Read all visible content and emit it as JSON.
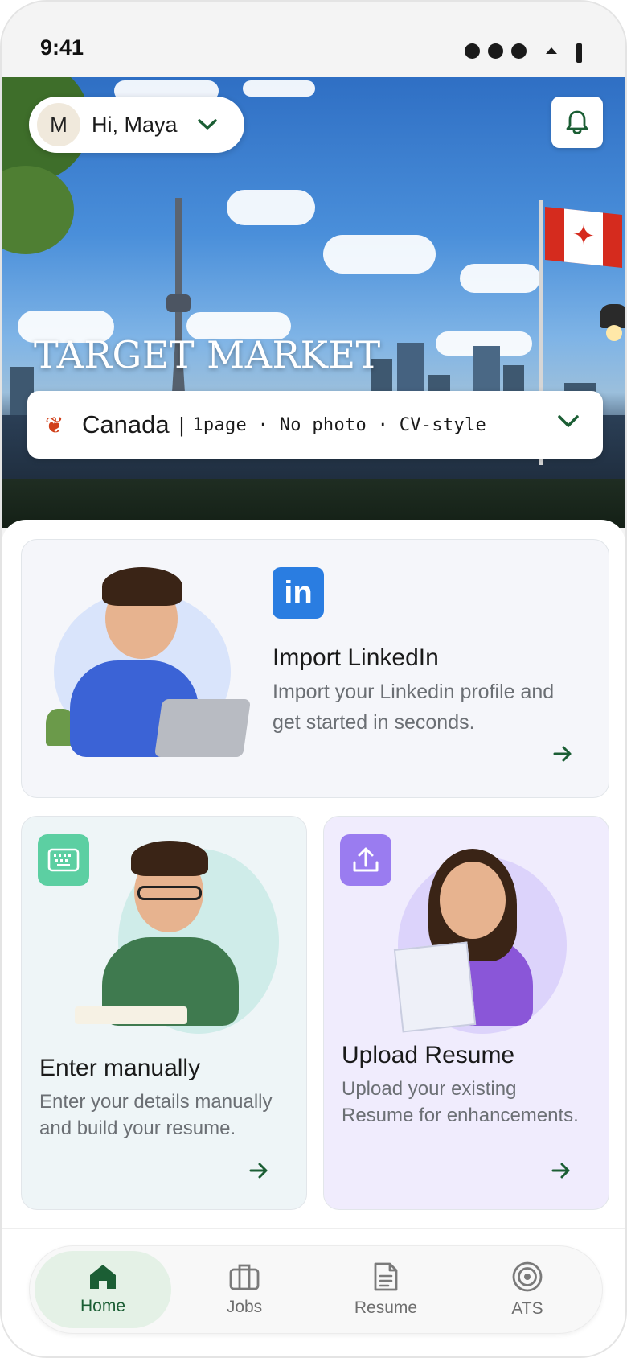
{
  "status_bar": {
    "time": "9:41"
  },
  "header": {
    "avatar_initial": "M",
    "greeting": "Hi, Maya"
  },
  "hero": {
    "title": "TARGET MARKET",
    "market": {
      "country": "Canada",
      "separator": "|",
      "details": "1page · No photo · CV-style"
    }
  },
  "cards": {
    "linkedin": {
      "logo_text": "in",
      "title": "Import LinkedIn",
      "description": "Import your Linkedin profile and get started in seconds."
    },
    "manual": {
      "title": "Enter manually",
      "description": "Enter your details manually and build your resume."
    },
    "upload": {
      "title": "Upload Resume",
      "description": "Upload your existing Resume for enhancements."
    }
  },
  "nav": {
    "items": [
      {
        "label": "Home",
        "icon": "home-icon",
        "active": true
      },
      {
        "label": "Jobs",
        "icon": "briefcase-icon",
        "active": false
      },
      {
        "label": "Resume",
        "icon": "document-icon",
        "active": false
      },
      {
        "label": "ATS",
        "icon": "target-icon",
        "active": false
      }
    ]
  },
  "colors": {
    "accent_green": "#1b5e34",
    "active_nav_bg": "#e4f1e6",
    "linkedin_blue": "#2a7de1",
    "keyboard_tile": "#5ccfa2",
    "upload_tile": "#9a7cf0",
    "flag_red": "#d52b1e"
  }
}
